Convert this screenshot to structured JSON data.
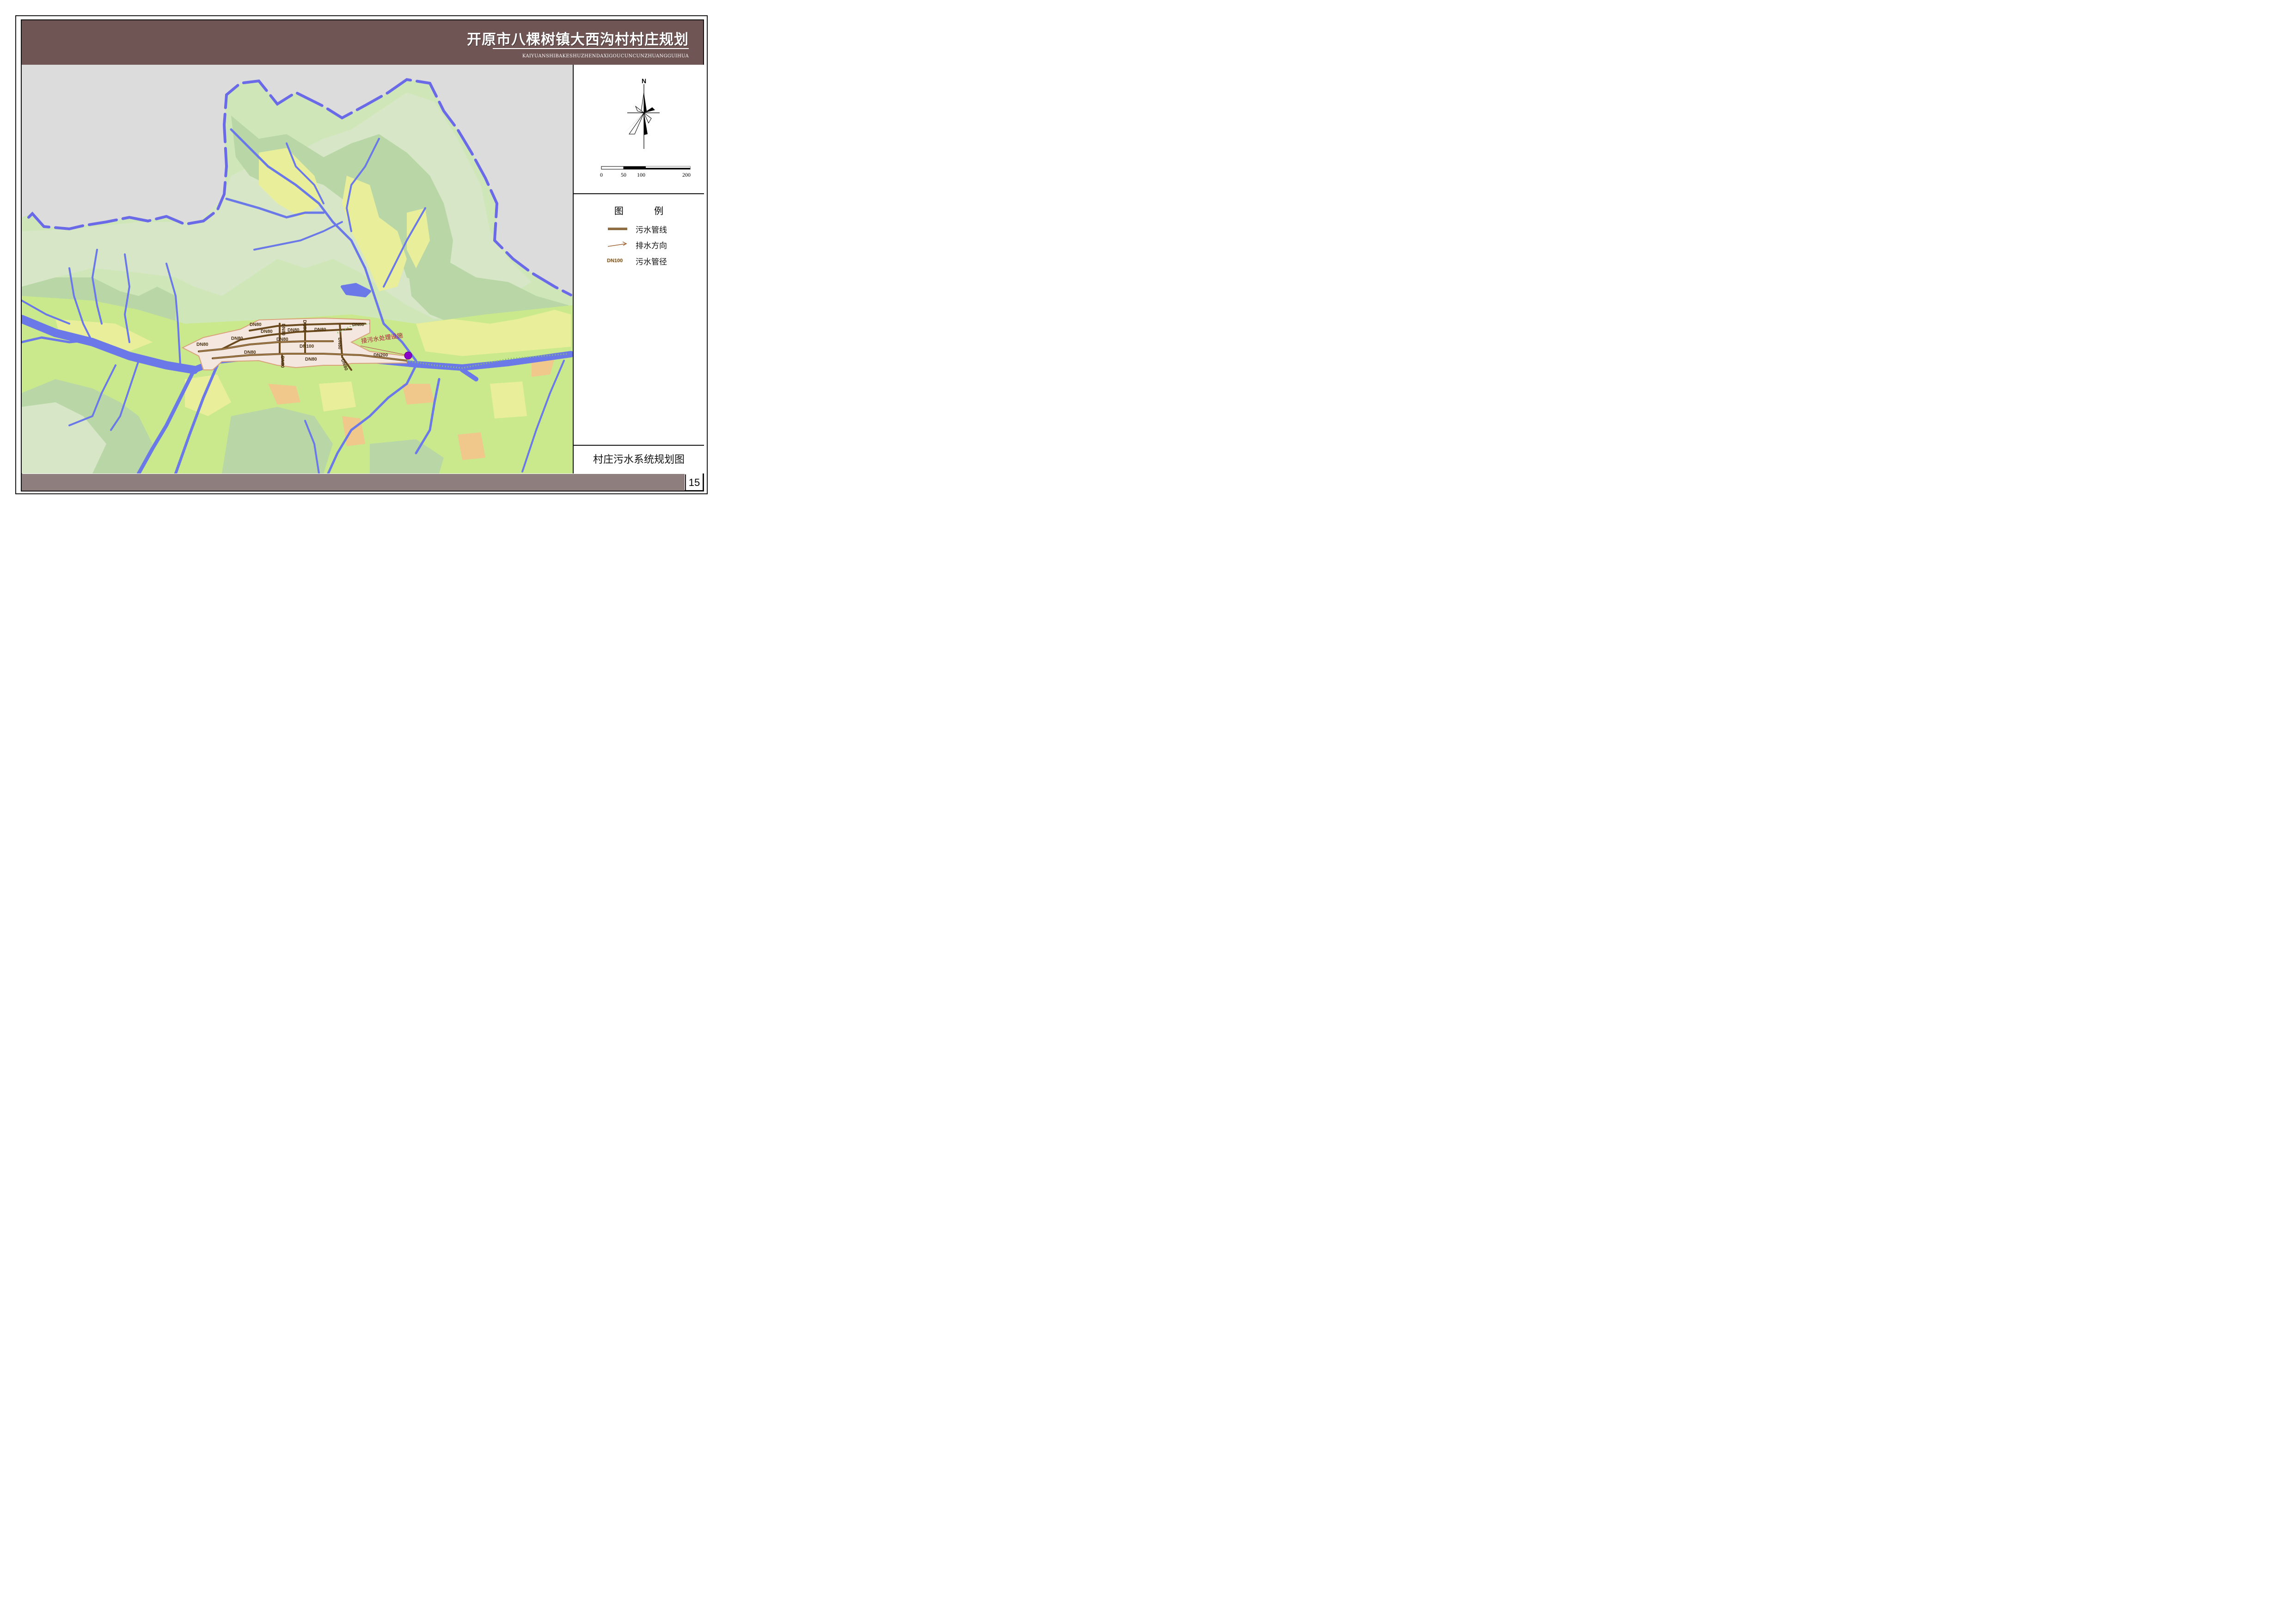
{
  "header": {
    "title": "开原市八棵树镇大西沟村村庄规划",
    "subtitle": "KAIYUANSHIBAKESHUZHENDAXIGOUCUNCUNZHUANGGUIHUA"
  },
  "north_arrow": {
    "letter": "N"
  },
  "scale_bar": {
    "labels": [
      "0",
      "50",
      "100",
      "200"
    ]
  },
  "legend": {
    "title": "图    例",
    "items": [
      {
        "symbol": "sewer-pipe-line",
        "label": "污水管线",
        "color": "#6b4a1e"
      },
      {
        "symbol": "drain-direction-arrow",
        "label": "排水方向",
        "color": "#a0683a"
      },
      {
        "symbol": "DN100",
        "label": "污水管径"
      }
    ]
  },
  "map_name": "村庄污水系统规划图",
  "page_number": "15",
  "map_labels": {
    "facility": "接污水处理设施",
    "pipes": [
      "DN80",
      "DN80",
      "DN80",
      "DN80",
      "DN80",
      "DN80",
      "DN80",
      "DN80",
      "DN100",
      "DN80",
      "DN80",
      "DN200",
      "DN80",
      "DN80",
      "DN80",
      "DN80",
      "DN80"
    ]
  },
  "colors": {
    "header_band": "#705555",
    "footer_band": "#8e7e7e",
    "river": "#6a78e8",
    "mountain_dark": "#b9d7a6",
    "mountain_light": "#d6e6c6",
    "farmland_yellow": "#e9ee9a",
    "farmland_green": "#c9e98c",
    "farmland_orange": "#f0c88c",
    "outside_area": "#dcdcdc",
    "sewer_pipe": "#6b4a1e",
    "facility_marker": "#8b00c8"
  }
}
